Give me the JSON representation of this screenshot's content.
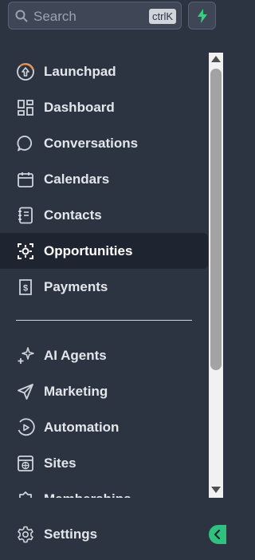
{
  "search": {
    "placeholder": "Search",
    "shortcut": "ctrlK"
  },
  "quick_action": {
    "icon": "lightning-bolt-icon",
    "color": "#35d07f"
  },
  "nav": {
    "items": [
      {
        "label": "Launchpad",
        "icon": "launchpad-icon"
      },
      {
        "label": "Dashboard",
        "icon": "dashboard-grid-icon"
      },
      {
        "label": "Conversations",
        "icon": "chat-bubble-icon"
      },
      {
        "label": "Calendars",
        "icon": "calendar-icon"
      },
      {
        "label": "Contacts",
        "icon": "contacts-book-icon"
      },
      {
        "label": "Opportunities",
        "icon": "opportunities-icon",
        "active": true
      },
      {
        "label": "Payments",
        "icon": "payments-receipt-icon"
      }
    ],
    "items2": [
      {
        "label": "AI Agents",
        "icon": "sparkle-icon"
      },
      {
        "label": "Marketing",
        "icon": "send-plane-icon"
      },
      {
        "label": "Automation",
        "icon": "automation-play-icon"
      },
      {
        "label": "Sites",
        "icon": "sites-globe-icon"
      },
      {
        "label": "Memberships",
        "icon": "memberships-icon"
      }
    ]
  },
  "footer": {
    "settings_label": "Settings"
  },
  "colors": {
    "sidebar_bg": "#2d3441",
    "active_bg": "#1f2530",
    "accent": "#2ec27e"
  }
}
